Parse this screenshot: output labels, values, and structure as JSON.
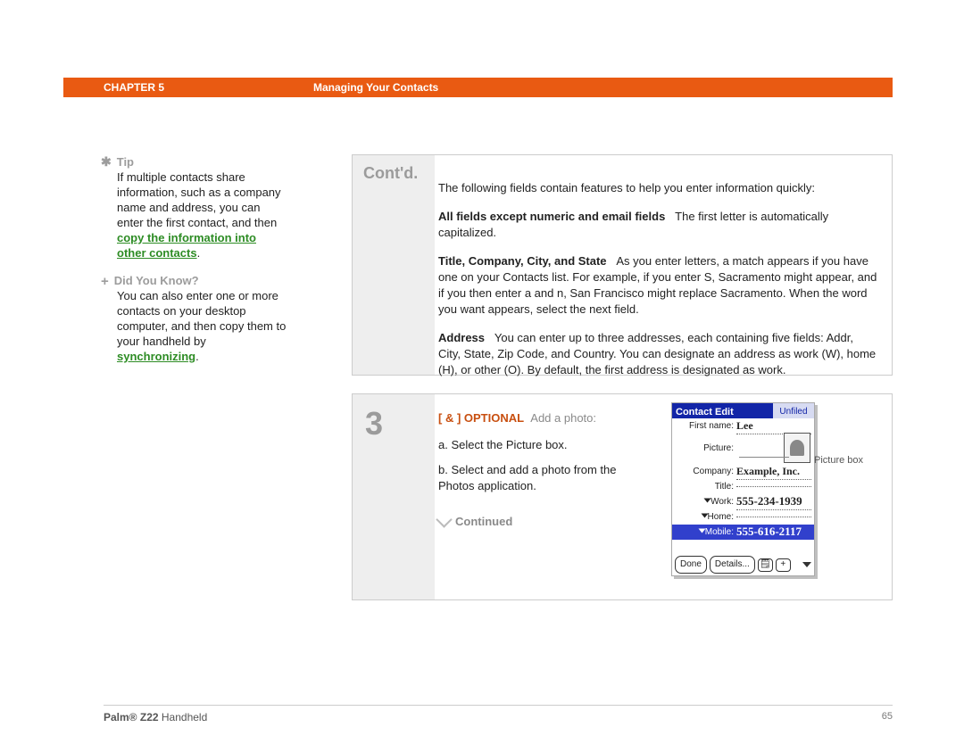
{
  "banner": {
    "chapter": "CHAPTER 5",
    "title": "Managing Your Contacts"
  },
  "sidebar": {
    "tip_label": "Tip",
    "tip_body_before": "If multiple contacts share information, such as a company name and address, you can enter the first contact, and then ",
    "tip_link": "copy the information into other contacts",
    "tip_after": ".",
    "dyk_label": "Did You Know?",
    "dyk_body_before": "You can also enter one or more contacts on your desktop computer, and then copy them to your handheld by ",
    "dyk_link": "synchronizing",
    "dyk_after": "."
  },
  "contd": {
    "label": "Cont'd.",
    "intro": "The following fields contain features to help you enter information quickly:",
    "f1_head": "All fields except numeric and email fields",
    "f1_body": "The first letter is automatically capitalized.",
    "f2_head": "Title, Company, City, and State",
    "f2_body": "As you enter letters, a match appears if you have one on your Contacts list. For example, if you enter S, Sacramento might appear, and if you then enter a and n, San Francisco might replace Sacramento. When the word you want appears, select the next field.",
    "f3_head": "Address",
    "f3_body": "You can enter up to three addresses, each containing five fields: Addr, City, State, Zip Code, and Country. You can designate an address as work (W), home (H), or other (O). By default, the first address is designated as work."
  },
  "step3": {
    "number": "3",
    "optional_prefix": "[ & ] OPTIONAL",
    "optional_text": "Add a photo:",
    "line_a": "a.  Select the Picture box.",
    "line_b": "b.  Select and add a photo from the Photos application.",
    "continued": "Continued"
  },
  "palm": {
    "header_left": "Contact Edit",
    "header_right": "Unfiled",
    "first_name_lbl": "First name:",
    "first_name_val": "Lee",
    "picture_lbl": "Picture:",
    "company_lbl": "Company:",
    "company_val": "Example, Inc.",
    "title_lbl": "Title:",
    "work_lbl": "Work:",
    "work_val": "555-234-1939",
    "home_lbl": "Home:",
    "mobile_lbl": "Mobile:",
    "mobile_val": "555-616-2117",
    "done_btn": "Done",
    "details_btn": "Details...",
    "note_icon": "🗒",
    "plus_icon": "+",
    "callout": "Picture box"
  },
  "footer": {
    "left_brand": "Palm® Z22",
    "left_rest": " Handheld",
    "page": "65"
  }
}
